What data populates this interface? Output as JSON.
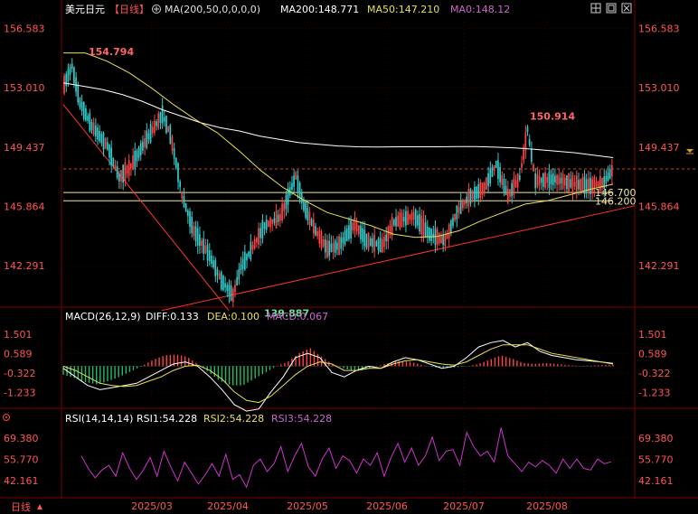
{
  "header": {
    "symbol": "美元日元",
    "period": "【日线】",
    "ma_formula": "MA(200,50,0,0,0,0)",
    "ma200": "MA200:148.771",
    "ma50": "MA50:147.210",
    "ma0": "MA0:148.12"
  },
  "macd_header": {
    "formula": "MACD(26,12,9)",
    "diff": "DIFF:0.133",
    "dea": "DEA:0.100",
    "macd": "MACD:0.067"
  },
  "rsi_header": {
    "formula": "RSI(14,14,14)",
    "rsi1": "RSI1:54.228",
    "rsi2": "RSI2:54.228",
    "rsi3": "RSI3:54.228"
  },
  "footer": {
    "period_button": "日线"
  },
  "icons": [
    "circle-plus-icon",
    "grid-icon",
    "restore-icon",
    "close-icon",
    "marker-arrow-icon",
    "menu-icon"
  ],
  "colors": {
    "up": "#ff4444",
    "down": "#33cccc",
    "ma200": "#ffffff",
    "ma50": "#e8e055",
    "rsi": "#cc33cc",
    "diff": "#ffffff",
    "dea": "#e8e055",
    "trend": "#ff3333"
  },
  "chart_data": [
    {
      "type": "candlestick",
      "panel": "price",
      "x_tick_labels": [
        "2025/03",
        "2025/04",
        "2025/05",
        "2025/06",
        "2025/07",
        "2025/08"
      ],
      "y_tick_labels": [
        "156.583",
        "153.010",
        "149.437",
        "145.864",
        "142.291"
      ],
      "ylim": [
        139.8,
        157.2
      ],
      "annotations": [
        {
          "label": "154.794",
          "value": 154.794,
          "type": "high"
        },
        {
          "label": "150.914",
          "value": 150.914,
          "type": "high"
        },
        {
          "label": "139.887",
          "value": 139.887,
          "type": "low"
        }
      ],
      "horizontal_levels": [
        {
          "label": "146.700",
          "value": 146.7
        },
        {
          "label": "146.200",
          "value": 146.2
        },
        {
          "value": 148.12,
          "style": "dashed"
        }
      ],
      "series": [
        {
          "name": "MA200",
          "values": [
            153.3,
            153.1,
            152.9,
            152.6,
            152.2,
            151.7,
            151.3,
            150.9,
            150.6,
            150.4,
            150.1,
            149.9,
            149.7,
            149.6,
            149.5,
            149.45,
            149.44,
            149.45,
            149.45,
            149.45,
            149.46,
            149.46,
            149.43,
            149.38,
            149.3,
            149.2,
            149.1,
            148.95,
            148.8
          ]
        },
        {
          "name": "MA50",
          "values": [
            155.1,
            155.1,
            154.6,
            153.9,
            153.0,
            152.0,
            151.1,
            150.3,
            149.2,
            148.0,
            147.0,
            146.2,
            145.5,
            145.1,
            144.7,
            144.2,
            144.0,
            144.05,
            144.4,
            145.0,
            145.5,
            146.0,
            146.2,
            146.55,
            146.9,
            147.2
          ]
        },
        {
          "name": "MACD",
          "values": [
            -0.4,
            -0.55,
            -0.75,
            -0.85,
            -0.7,
            -0.5,
            -0.25,
            0.0,
            0.3,
            0.5,
            0.55,
            0.45,
            0.1,
            -0.3,
            -0.7,
            -0.9,
            -0.9,
            -0.6,
            -0.3,
            0.0,
            0.2,
            0.6,
            0.85,
            0.45,
            0.1,
            -0.1,
            -0.25,
            -0.15,
            0.0,
            0.15,
            0.25,
            0.2,
            0.05,
            -0.05,
            -0.1,
            -0.05,
            0.0,
            0.1,
            0.3,
            0.5,
            0.35,
            0.15,
            0.1,
            0.15,
            0.1,
            0.05,
            0.02,
            0.03,
            0.05,
            0.067
          ]
        },
        {
          "name": "DIFF",
          "values": [
            -0.1,
            -0.5,
            -0.9,
            -1.1,
            -1.0,
            -0.9,
            -0.8,
            -0.5,
            -0.2,
            0.1,
            0.2,
            0.0,
            -0.5,
            -1.1,
            -1.8,
            -2.1,
            -2.0,
            -1.2,
            -0.5,
            0.4,
            0.6,
            0.4,
            -0.3,
            -0.5,
            -0.2,
            0.0,
            -0.1,
            0.2,
            0.4,
            0.3,
            0.1,
            -0.1,
            0.0,
            0.4,
            0.9,
            1.1,
            1.2,
            0.9,
            1.1,
            0.7,
            0.5,
            0.4,
            0.3,
            0.25,
            0.2,
            0.133
          ]
        },
        {
          "name": "DEA",
          "values": [
            0.0,
            -0.2,
            -0.5,
            -0.8,
            -0.9,
            -0.95,
            -0.9,
            -0.7,
            -0.5,
            -0.2,
            0.0,
            0.05,
            -0.2,
            -0.6,
            -1.2,
            -1.6,
            -1.7,
            -1.4,
            -0.9,
            -0.4,
            0.0,
            0.2,
            0.1,
            -0.2,
            -0.2,
            -0.1,
            -0.1,
            0.1,
            0.25,
            0.3,
            0.2,
            0.1,
            0.05,
            0.2,
            0.5,
            0.8,
            1.0,
            1.0,
            1.0,
            0.8,
            0.6,
            0.5,
            0.4,
            0.3,
            0.2,
            0.1
          ]
        },
        {
          "name": "RSI1",
          "values": [
            58,
            50,
            44,
            49,
            52,
            45,
            60,
            50,
            43,
            49,
            57,
            45,
            61,
            51,
            42,
            54,
            47,
            40,
            46,
            53,
            45,
            59,
            43,
            46,
            38,
            52,
            56,
            48,
            53,
            64,
            48,
            58,
            66,
            51,
            45,
            56,
            63,
            50,
            58,
            55,
            47,
            56,
            52,
            60,
            45,
            57,
            66,
            54,
            63,
            52,
            58,
            70,
            55,
            61,
            62,
            52,
            73,
            64,
            58,
            61,
            54,
            76,
            58,
            53,
            48,
            54,
            51,
            55,
            52,
            47,
            56,
            50,
            56,
            50,
            49,
            56,
            53,
            54.228
          ]
        }
      ]
    },
    {
      "type": "bar",
      "panel": "macd",
      "title": "MACD(26,12,9)",
      "y_tick_labels": [
        "1.501",
        "0.589",
        "-0.322",
        "-1.233"
      ],
      "ylim": [
        -1.8,
        2.0
      ]
    },
    {
      "type": "line",
      "panel": "rsi",
      "title": "RSI(14,14,14)",
      "y_tick_labels": [
        "69.380",
        "55.770",
        "42.161"
      ],
      "ylim": [
        33,
        78
      ]
    }
  ]
}
